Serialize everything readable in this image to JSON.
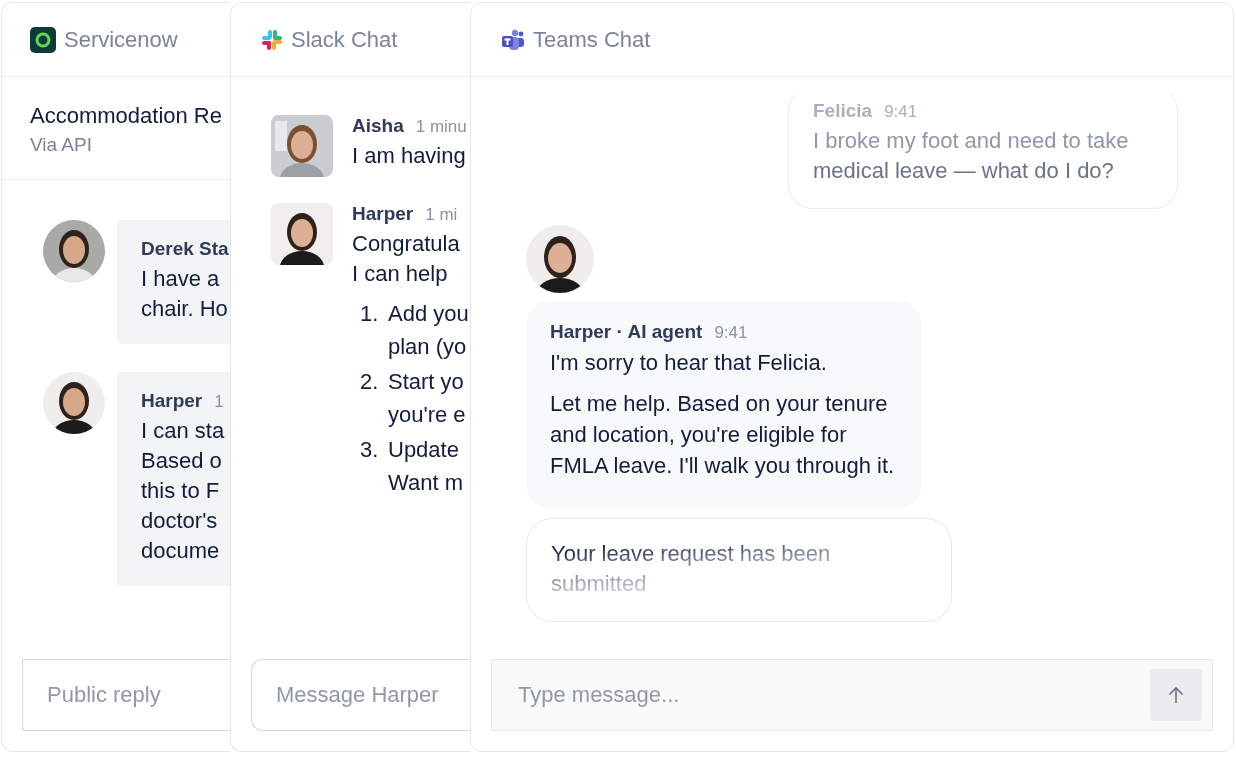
{
  "servicenow": {
    "title": "Servicenow",
    "ticket": {
      "title": "Accommodation Re",
      "subtitle": "Via API"
    },
    "messages": [
      {
        "author": "Derek Sta",
        "lines": [
          "I have a",
          "chair. Ho"
        ]
      },
      {
        "author": "Harper",
        "time": "1",
        "lines": [
          "I can sta",
          "Based o",
          "this to F",
          "doctor's",
          "docume"
        ]
      }
    ],
    "reply": {
      "placeholder": "Public reply"
    }
  },
  "slack": {
    "title": "Slack Chat",
    "messages": [
      {
        "author": "Aisha",
        "time": "1 minu",
        "lines": [
          "I am having"
        ]
      },
      {
        "author": "Harper",
        "time": "1 mi",
        "lines": [
          "Congratula",
          "I can help"
        ],
        "list": [
          {
            "number": "1.",
            "lines": [
              "Add you",
              "plan (yo"
            ]
          },
          {
            "number": "2.",
            "lines": [
              "Start yo",
              "you're e"
            ]
          },
          {
            "number": "3.",
            "lines": [
              "Update",
              "Want m"
            ]
          }
        ]
      }
    ],
    "input": {
      "placeholder": "Message Harper"
    }
  },
  "teams": {
    "title": "Teams Chat",
    "incoming": {
      "author": "Felicia",
      "time": "9:41",
      "lines": [
        "I broke my foot and need to take",
        "medical leave — what do I do?"
      ]
    },
    "reply": {
      "author": "Harper · AI agent",
      "time": "9:41",
      "paragraphs": [
        "I'm sorry to hear that Felicia.",
        "Let me help. Based on your tenure and location, you're eligible for FMLA leave. I'll walk you through it."
      ]
    },
    "status": "Your leave request has been submitted",
    "input": {
      "placeholder": "Type message..."
    }
  }
}
